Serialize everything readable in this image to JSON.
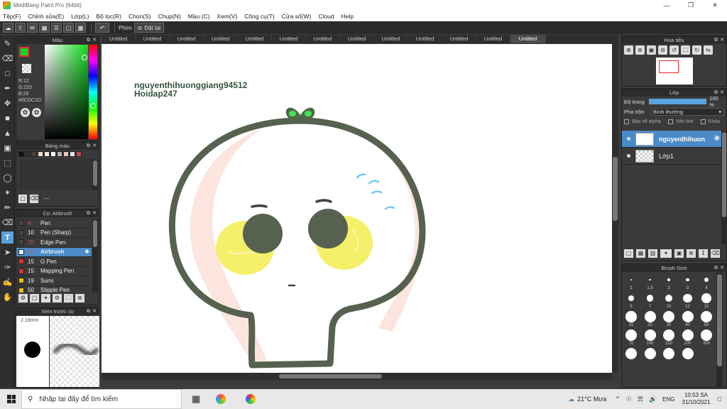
{
  "window": {
    "title": "MediBang Paint Pro (64bit)"
  },
  "menu": [
    "Tệp(F)",
    "Chỉnh sửa(E)",
    "Lớp(L)",
    "Bộ lọc(R)",
    "Chọn(S)",
    "Chụp(N)",
    "Màu (C)",
    "Xem(V)",
    "Công cụ(T)",
    "Cửa sổ(W)",
    "Cloud",
    "Help"
  ],
  "toolbar": {
    "key_label": "Phím",
    "reset_label": "Đặt lại"
  },
  "color_panel": {
    "title": "Màu",
    "r": "R:12",
    "g": "G:220",
    "b": "B:29",
    "hex": "#0CDC1D",
    "fg": "#0cdc1d"
  },
  "palette_panel": {
    "title": "Bảng màu",
    "more": "---",
    "swatches": [
      "#111111",
      "#333333",
      "#444444",
      "#f2d9d0",
      "#f5e6e0",
      "#ffffff",
      "#b7b1a8",
      "#e9c6c6",
      "#e7e7e7",
      "#c44c4c"
    ]
  },
  "brush_panel": {
    "title": "Cọ: Airbrush",
    "items": [
      {
        "num": "4",
        "name": "Pen",
        "color": "#444444",
        "numcolor": "#e05555"
      },
      {
        "num": "10",
        "name": "Pen (Sharp)",
        "color": "#444444",
        "numcolor": "#eeeeee"
      },
      {
        "num": "70",
        "name": "Edge Pen",
        "color": "#444444",
        "numcolor": "#e05555"
      },
      {
        "num": "30",
        "name": "Airbrush",
        "color": "#eeeeee",
        "numcolor": "#e05555",
        "selected": true
      },
      {
        "num": "15",
        "name": "G Pen",
        "color": "#dd3333",
        "numcolor": "#eeeeee"
      },
      {
        "num": "15",
        "name": "Mapping Pen",
        "color": "#dd3333",
        "numcolor": "#eeeeee"
      },
      {
        "num": "19",
        "name": "Sumi",
        "color": "#e6c200",
        "numcolor": "#eeeeee"
      },
      {
        "num": "50",
        "name": "Stipple Pen",
        "color": "#e6c200",
        "numcolor": "#eeeeee"
      }
    ]
  },
  "preview_panel": {
    "title": "Xem trước cọ",
    "size": "2.18mm"
  },
  "tabs": [
    "Untitled",
    "Untitled",
    "Untitled",
    "Untitled",
    "Untitled",
    "Untitled",
    "Untitled",
    "Untitled",
    "Untitled",
    "Untitled",
    "Untitled",
    "Untitled",
    "Untitled"
  ],
  "canvas": {
    "watermark1": "nguyenthihuonggiang94512",
    "watermark2": "Hoidap247"
  },
  "navigator": {
    "title": "Hoa tiêu"
  },
  "layer_panel": {
    "title": "Lớp",
    "opacity_label": "Độ trong",
    "opacity_value": "100 %",
    "opacity": 1.0,
    "blend_label": "Pha trộn",
    "blend_value": "Bình thường",
    "protect_alpha": "Bảo vệ alpha",
    "clipping": "Xén bớt",
    "lock": "Khóa",
    "layers": [
      {
        "name": "nguyenthihuon",
        "selected": true
      },
      {
        "name": "Lớp1",
        "selected": false
      }
    ]
  },
  "brushsize_panel": {
    "title": "Brush Size",
    "sizes": [
      "1",
      "1.5",
      "2",
      "3",
      "4",
      "5",
      "7",
      "10",
      "12",
      "15",
      "20",
      "25",
      "30",
      "40",
      "50",
      "70",
      "100",
      "150",
      "200",
      "300",
      "",
      "",
      "",
      ""
    ]
  },
  "taskbar": {
    "search_placeholder": "Nhập tại đây để tìm kiếm",
    "weather": "21°C Mưa",
    "lang": "ENG",
    "time": "10:53 SA",
    "date": "31/10/2021"
  }
}
